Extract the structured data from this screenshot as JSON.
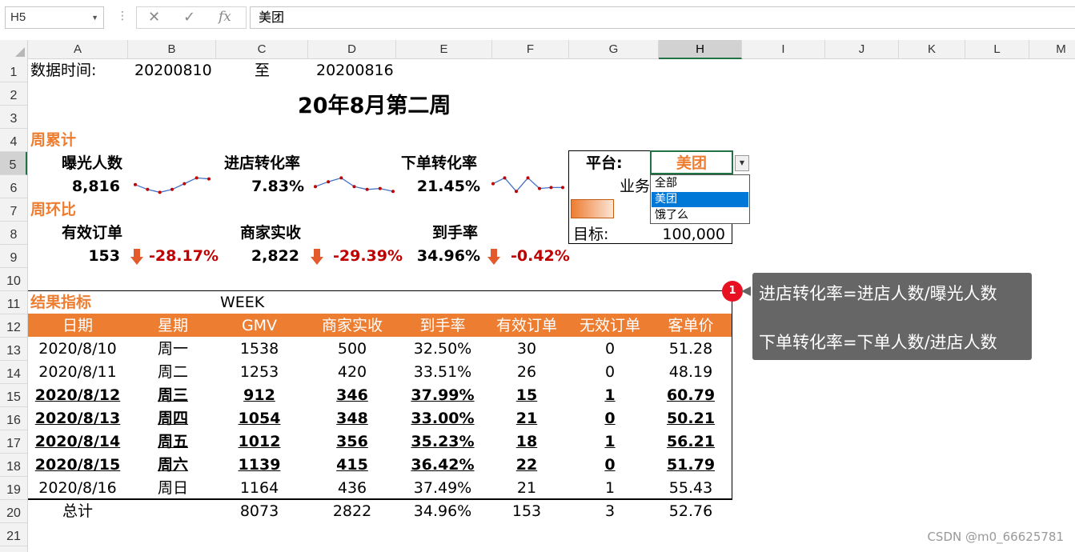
{
  "formula_bar": {
    "name_box": "H5",
    "cancel_icon": "✕",
    "enter_icon": "✓",
    "fx_label": "fx",
    "formula": "美团"
  },
  "columns": [
    "A",
    "B",
    "C",
    "D",
    "E",
    "F",
    "G",
    "H",
    "I",
    "J",
    "K",
    "L",
    "M"
  ],
  "rows": [
    "1",
    "2",
    "3",
    "4",
    "5",
    "6",
    "7",
    "8",
    "9",
    "10",
    "11",
    "12",
    "13",
    "14",
    "15",
    "16",
    "17",
    "18",
    "19",
    "20",
    "21"
  ],
  "selected_cell": "H5",
  "sheet": {
    "date_label": "数据时间:",
    "date_start": "20200810",
    "date_to": "至",
    "date_end": "20200816",
    "title": "20年8月第二周",
    "weekly_total_label": "周累计",
    "impressions_label": "曝光人数",
    "impressions_value": "8,816",
    "enter_rate_label": "进店转化率",
    "enter_rate_value": "7.83%",
    "order_rate_label": "下单转化率",
    "order_rate_value": "21.45%",
    "wow_label": "周环比",
    "valid_orders_label": "有效订单",
    "valid_orders_value": "153",
    "valid_orders_change": "-28.17%",
    "merchant_label": "商家实收",
    "merchant_value": "2,822",
    "merchant_change": "-29.39%",
    "arrival_label": "到手率",
    "arrival_value": "34.96%",
    "arrival_change": "-0.42%",
    "result_label": "结果指标",
    "week_label": "WEEK"
  },
  "sparklines": {
    "impressions": [
      0.55,
      0.3,
      0.15,
      0.3,
      0.6,
      0.9,
      0.85
    ],
    "enter_rate": [
      0.45,
      0.7,
      0.9,
      0.45,
      0.3,
      0.35,
      0.2
    ],
    "order_rate": [
      0.6,
      0.9,
      0.2,
      0.9,
      0.35,
      0.4,
      0.4
    ]
  },
  "panel": {
    "platform_label": "平台:",
    "platform_value": "美团",
    "business_label": "业务",
    "options": [
      "全部",
      "美团",
      "饿了么"
    ],
    "selected_option": 1,
    "target_label": "目标:",
    "target_value": "100,000"
  },
  "table": {
    "headers": [
      "日期",
      "星期",
      "GMV",
      "商家实收",
      "到手率",
      "有效订单",
      "无效订单",
      "客单价"
    ],
    "rows": [
      {
        "bold": false,
        "cells": [
          "2020/8/10",
          "周一",
          "1538",
          "500",
          "32.50%",
          "30",
          "0",
          "51.28"
        ]
      },
      {
        "bold": false,
        "cells": [
          "2020/8/11",
          "周二",
          "1253",
          "420",
          "33.51%",
          "26",
          "0",
          "48.19"
        ]
      },
      {
        "bold": true,
        "cells": [
          "2020/8/12",
          "周三",
          "912",
          "346",
          "37.99%",
          "15",
          "1",
          "60.79"
        ]
      },
      {
        "bold": true,
        "cells": [
          "2020/8/13",
          "周四",
          "1054",
          "348",
          "33.00%",
          "21",
          "0",
          "50.21"
        ]
      },
      {
        "bold": true,
        "cells": [
          "2020/8/14",
          "周五",
          "1012",
          "356",
          "35.23%",
          "18",
          "1",
          "56.21"
        ]
      },
      {
        "bold": true,
        "cells": [
          "2020/8/15",
          "周六",
          "1139",
          "415",
          "36.42%",
          "22",
          "0",
          "51.79"
        ]
      },
      {
        "bold": false,
        "cells": [
          "2020/8/16",
          "周日",
          "1164",
          "436",
          "37.49%",
          "21",
          "1",
          "55.43"
        ]
      }
    ],
    "total": [
      "总计",
      "",
      "8073",
      "2822",
      "34.96%",
      "153",
      "3",
      "52.76"
    ]
  },
  "comment": {
    "badge": "1",
    "line1": "进店转化率=进店人数/曝光人数",
    "line2": "下单转化率=下单人数/进店人数"
  },
  "watermark": "CSDN @m0_66625781",
  "colors": {
    "accent": "#ed7d31",
    "negative": "#c00000",
    "selection": "#217346",
    "sparkline": "#4472c4",
    "sparkline_point": "#c00000"
  }
}
